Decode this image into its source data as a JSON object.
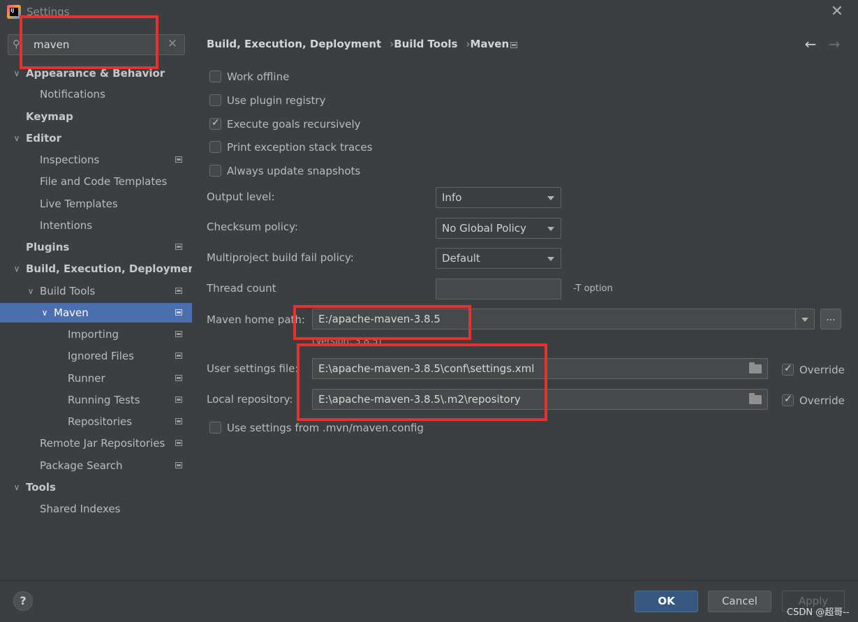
{
  "window": {
    "title": "Settings",
    "close_icon": "close-icon"
  },
  "search": {
    "value": "maven",
    "placeholder": ""
  },
  "sidebar": {
    "items": [
      {
        "label": "Appearance & Behavior",
        "bold": true,
        "expanded": true
      },
      {
        "label": "Notifications"
      },
      {
        "label": "Keymap",
        "bold": true
      },
      {
        "label": "Editor",
        "bold": true,
        "expanded": true
      },
      {
        "label": "Inspections"
      },
      {
        "label": "File and Code Templates"
      },
      {
        "label": "Live Templates"
      },
      {
        "label": "Intentions"
      },
      {
        "label": "Plugins",
        "bold": true
      },
      {
        "label": "Build, Execution, Deployment",
        "bold": true,
        "expanded": true
      },
      {
        "label": "Build Tools",
        "expanded": true
      },
      {
        "label": "Maven",
        "expanded": true,
        "selected": true
      },
      {
        "label": "Importing"
      },
      {
        "label": "Ignored Files"
      },
      {
        "label": "Runner"
      },
      {
        "label": "Running Tests"
      },
      {
        "label": "Repositories"
      },
      {
        "label": "Remote Jar Repositories"
      },
      {
        "label": "Package Search"
      },
      {
        "label": "Tools",
        "bold": true,
        "expanded": true
      },
      {
        "label": "Shared Indexes"
      }
    ]
  },
  "breadcrumb": [
    "Build, Execution, Deployment",
    "Build Tools",
    "Maven"
  ],
  "breadcrumb_sep": "›",
  "nav": {
    "back": "←",
    "forward": "→"
  },
  "checkboxes": [
    {
      "label": "Work offline",
      "checked": false
    },
    {
      "label": "Use plugin registry",
      "checked": false
    },
    {
      "label": "Execute goals recursively",
      "checked": true
    },
    {
      "label": "Print exception stack traces",
      "checked": false
    },
    {
      "label": "Always update snapshots",
      "checked": false
    }
  ],
  "fields": {
    "output_level": {
      "label": "Output level:",
      "value": "Info"
    },
    "checksum_policy": {
      "label": "Checksum policy:",
      "value": "No Global Policy"
    },
    "multiproject_policy": {
      "label": "Multiproject build fail policy:",
      "value": "Default"
    },
    "thread_count": {
      "label": "Thread count",
      "value": "",
      "hint": "-T option"
    },
    "maven_home": {
      "label": "Maven home path:",
      "value": "E:/apache-maven-3.8.5",
      "version": "(Version: 3.8.5)",
      "browse": "..."
    },
    "user_settings": {
      "label": "User settings file:",
      "value": "E:\\apache-maven-3.8.5\\conf\\settings.xml",
      "override_label": "Override",
      "override": true
    },
    "local_repo": {
      "label": "Local repository:",
      "value": "E:\\apache-maven-3.8.5\\.m2\\repository",
      "override_label": "Override",
      "override": true
    },
    "mvn_config": {
      "label": "Use settings from .mvn/maven.config",
      "checked": false
    }
  },
  "buttons": {
    "help": "?",
    "ok": "OK",
    "cancel": "Cancel",
    "apply": "Apply"
  },
  "watermark": "CSDN @超哥--",
  "colors": {
    "background": "#3c3f41",
    "selection": "#4b6eaf",
    "ok_button": "#365880",
    "annotation": "#e8312f"
  }
}
